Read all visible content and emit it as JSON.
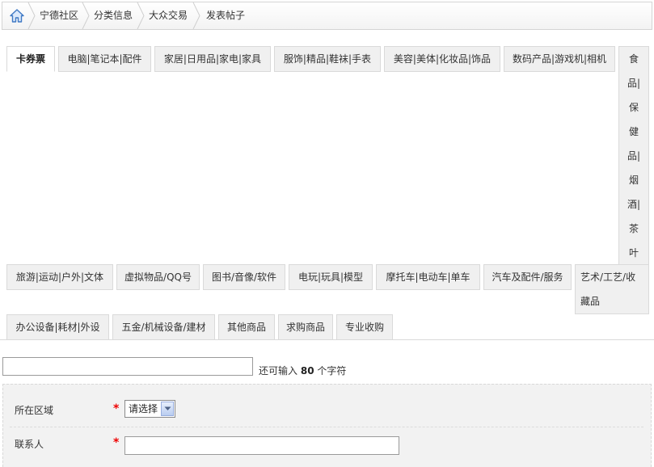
{
  "breadcrumb": {
    "home_icon": "home-icon",
    "items": [
      "宁德社区",
      "分类信息",
      "大众交易",
      "发表帖子"
    ]
  },
  "tabs": [
    "卡券票",
    "电脑|笔记本|配件",
    "家居|日用品|家电|家具",
    "服饰|精品|鞋袜|手表",
    "美容|美体|化妆品|饰品",
    "数码产品|游戏机|相机",
    "食品|保健品|烟酒|茶叶",
    "旅游|运动|户外|文体",
    "虚拟物品/QQ号",
    "图书/音像/软件",
    "电玩|玩具|模型",
    "摩托车|电动车|单车",
    "汽车及配件/服务",
    "艺术/工艺/收藏品",
    "办公设备|耗材|外设",
    "五金/机械设备/建材",
    "其他商品",
    "求购商品",
    "专业收购"
  ],
  "title_field": {
    "value": "",
    "hint_prefix": "还可输入",
    "hint_count": "80",
    "hint_suffix": "个字符"
  },
  "form": {
    "region_label": "所在区域",
    "region_select": "请选择",
    "contact_label": "联系人",
    "required_mark": "*",
    "contact_value": ""
  },
  "colors": {
    "required": "#e00000",
    "tab_bg": "#f0f0f0",
    "panel_bg": "#f2f2f2"
  }
}
